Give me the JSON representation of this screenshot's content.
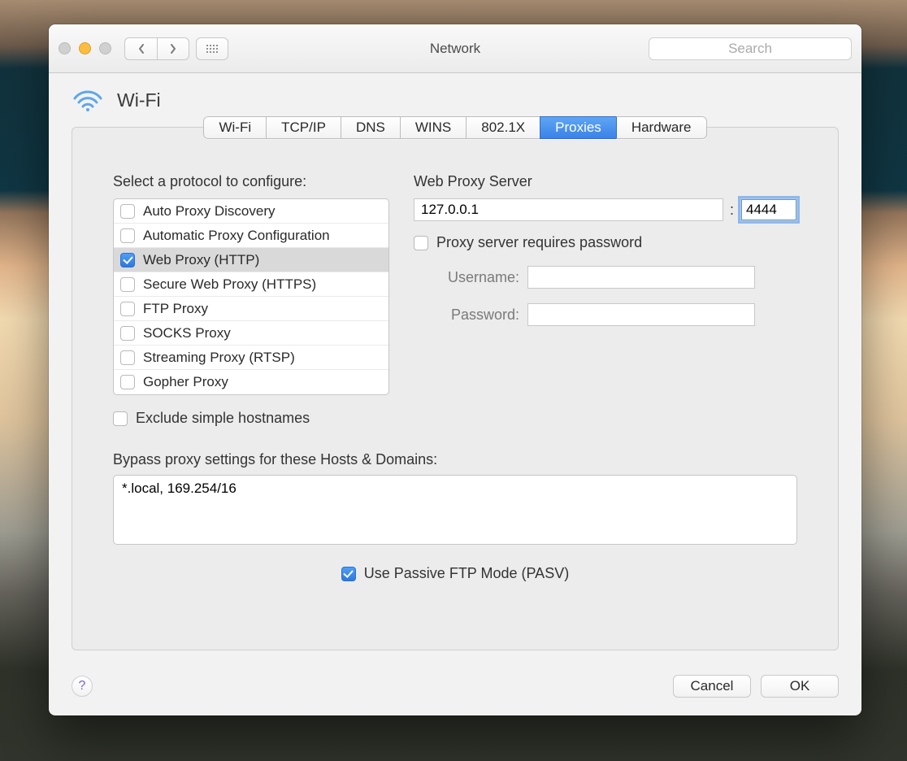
{
  "window": {
    "title": "Network"
  },
  "toolbar": {
    "search_placeholder": "Search"
  },
  "header": {
    "interface": "Wi-Fi"
  },
  "tabs": [
    {
      "label": "Wi-Fi"
    },
    {
      "label": "TCP/IP"
    },
    {
      "label": "DNS"
    },
    {
      "label": "WINS"
    },
    {
      "label": "802.1X"
    },
    {
      "label": "Proxies",
      "active": true
    },
    {
      "label": "Hardware"
    }
  ],
  "proxies": {
    "protocol_select_label": "Select a protocol to configure:",
    "protocols": [
      {
        "label": "Auto Proxy Discovery",
        "checked": false
      },
      {
        "label": "Automatic Proxy Configuration",
        "checked": false
      },
      {
        "label": "Web Proxy (HTTP)",
        "checked": true,
        "selected": true
      },
      {
        "label": "Secure Web Proxy (HTTPS)",
        "checked": false
      },
      {
        "label": "FTP Proxy",
        "checked": false
      },
      {
        "label": "SOCKS Proxy",
        "checked": false
      },
      {
        "label": "Streaming Proxy (RTSP)",
        "checked": false
      },
      {
        "label": "Gopher Proxy",
        "checked": false
      }
    ],
    "server_label": "Web Proxy Server",
    "server_host": "127.0.0.1",
    "server_port": "4444",
    "server_port_sep": ":",
    "requires_password_label": "Proxy server requires password",
    "requires_password": false,
    "username_label": "Username:",
    "username": "",
    "password_label": "Password:",
    "password": "",
    "exclude_simple_label": "Exclude simple hostnames",
    "exclude_simple": false,
    "bypass_label": "Bypass proxy settings for these Hosts & Domains:",
    "bypass_value": "*.local, 169.254/16",
    "passive_ftp_label": "Use Passive FTP Mode (PASV)",
    "passive_ftp": true
  },
  "footer": {
    "help": "?",
    "cancel": "Cancel",
    "ok": "OK"
  }
}
